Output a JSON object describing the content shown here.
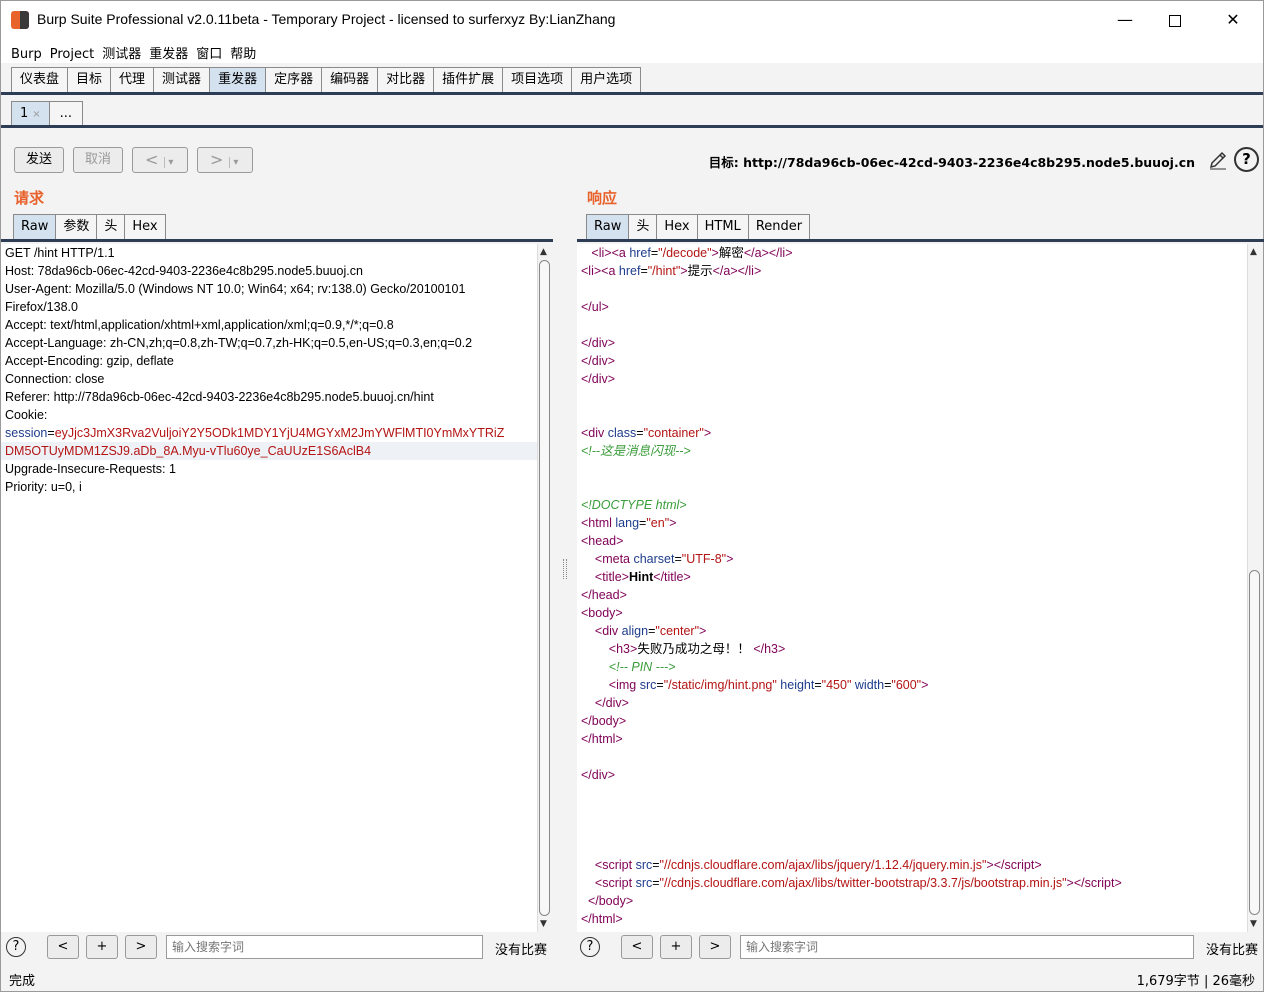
{
  "window": {
    "title": "Burp Suite Professional v2.0.11beta - Temporary Project - licensed to surferxyz By:LianZhang"
  },
  "menu": [
    "Burp",
    "Project",
    "测试器",
    "重发器",
    "窗口",
    "帮助"
  ],
  "main_tabs": [
    {
      "label": "仪表盘",
      "active": false
    },
    {
      "label": "目标",
      "active": false
    },
    {
      "label": "代理",
      "active": false
    },
    {
      "label": "测试器",
      "active": false
    },
    {
      "label": "重发器",
      "active": true
    },
    {
      "label": "定序器",
      "active": false
    },
    {
      "label": "编码器",
      "active": false
    },
    {
      "label": "对比器",
      "active": false
    },
    {
      "label": "插件扩展",
      "active": false
    },
    {
      "label": "项目选项",
      "active": false
    },
    {
      "label": "用户选项",
      "active": false
    }
  ],
  "sub_tabs": {
    "first": "1",
    "more": "..."
  },
  "toolbar": {
    "send": "发送",
    "cancel": "取消",
    "prev": "<",
    "next": ">",
    "dropdown": "▾",
    "target_label": "目标: http://78da96cb-06ec-42cd-9403-2236e4c8b295.node5.buuoj.cn",
    "help": "?"
  },
  "request": {
    "heading": "请求",
    "tabs": [
      "Raw",
      "参数",
      "头",
      "Hex"
    ],
    "lines": [
      "GET /hint HTTP/1.1",
      "Host: 78da96cb-06ec-42cd-9403-2236e4c8b295.node5.buuoj.cn",
      "User-Agent: Mozilla/5.0 (Windows NT 10.0; Win64; x64; rv:138.0) Gecko/20100101",
      "Firefox/138.0",
      "Accept: text/html,application/xhtml+xml,application/xml;q=0.9,*/*;q=0.8",
      "Accept-Language: zh-CN,zh;q=0.8,zh-TW;q=0.7,zh-HK;q=0.5,en-US;q=0.3,en;q=0.2",
      "Accept-Encoding: gzip, deflate",
      "Connection: close",
      "Referer: http://78da96cb-06ec-42cd-9403-2236e4c8b295.node5.buuoj.cn/hint",
      "Cookie:"
    ],
    "session_key": "session",
    "session_eq": "=",
    "session_val1": "eyJjc3JmX3Rva2VuljoiY2Y5ODk1MDY1YjU4MGYxM2JmYWFlMTI0YmMxYTRiZ",
    "session_val2": "DM5OTUyMDM1ZSJ9.aDb_8A.Myu-vTlu60ye_CaUUzE1S6AclB4",
    "lines_after": [
      "Upgrade-Insecure-Requests: 1",
      "Priority: u=0, i"
    ]
  },
  "response": {
    "heading": "响应",
    "tabs": [
      "Raw",
      "头",
      "Hex",
      "HTML",
      "Render"
    ]
  },
  "resp_text": {
    "li1_href": "\"/decode\"",
    "li1_text": "解密",
    "li2_href": "\"/hint\"",
    "li2_text": "提示",
    "container": "\"container\"",
    "comment1": "<!--这是消息闪现-->",
    "doctype": "<!DOCTYPE html>",
    "lang": "\"en\"",
    "charset": "\"UTF-8\"",
    "title": "Hint",
    "center": "\"center\"",
    "h3": "失败乃成功之母！！",
    "comment2": "<!-- PIN --->",
    "img_src": "\"/static/img/hint.png\"",
    "img_h": "\"450\"",
    "img_w": "\"600\"",
    "script1": "\"//cdnjs.cloudflare.com/ajax/libs/jquery/1.12.4/jquery.min.js\"",
    "script2": "\"//cdnjs.cloudflare.com/ajax/libs/twitter-bootstrap/3.3.7/js/bootstrap.min.js\""
  },
  "search": {
    "help": "?",
    "prev": "<",
    "add": "+",
    "next": ">",
    "placeholder": "输入搜索字词",
    "no_match": "没有比赛"
  },
  "status": {
    "left": "完成",
    "right": "1,679字节 | 26毫秒"
  }
}
